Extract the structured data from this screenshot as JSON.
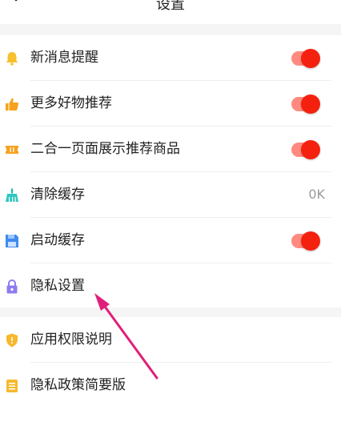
{
  "header": {
    "title": "设置"
  },
  "settings": [
    {
      "label": "新消息提醒",
      "icon": "bell-icon",
      "type": "toggle",
      "on": true
    },
    {
      "label": "更多好物推荐",
      "icon": "thumbs-up-icon",
      "type": "toggle",
      "on": true
    },
    {
      "label": "二合一页面展示推荐商品",
      "icon": "ticket-icon",
      "type": "toggle",
      "on": true
    },
    {
      "label": "清除缓存",
      "icon": "broom-icon",
      "type": "value",
      "value": "0K"
    },
    {
      "label": "启动缓存",
      "icon": "save-icon",
      "type": "toggle",
      "on": true
    },
    {
      "label": "隐私设置",
      "icon": "lock-icon",
      "type": "link"
    }
  ],
  "legal": [
    {
      "label": "应用权限说明",
      "icon": "shield-icon"
    },
    {
      "label": "隐私政策简要版",
      "icon": "document-icon"
    }
  ],
  "colors": {
    "accent": "#f5210f",
    "toggle_track": "#ff8a80",
    "arrow": "#e01f7a"
  }
}
